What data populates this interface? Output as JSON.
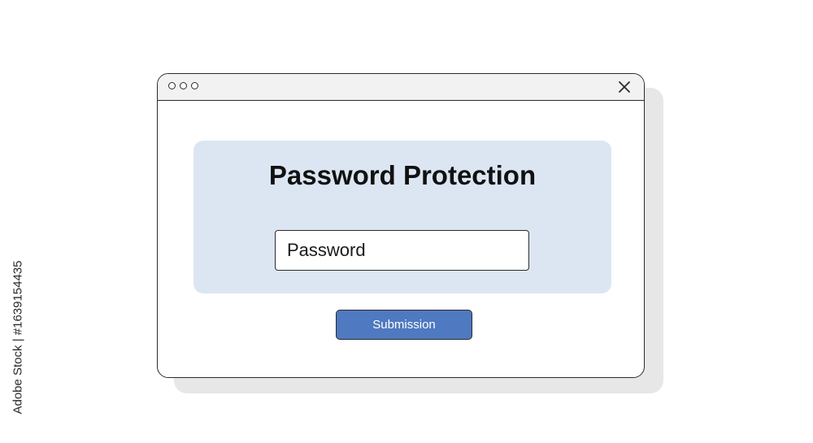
{
  "window": {
    "title_bar": {
      "dots": [
        "dot",
        "dot",
        "dot"
      ],
      "close_icon": "close-icon"
    }
  },
  "form": {
    "heading": "Password Protection",
    "password_placeholder": "Password",
    "password_value": "",
    "submit_label": "Submission"
  },
  "watermark": {
    "side_text": "Adobe Stock | #1639154435"
  },
  "colors": {
    "panel_background": "#dce6f3",
    "button_background": "#4f79c0",
    "titlebar_background": "#f2f2f2",
    "border": "#2b2b2b"
  }
}
